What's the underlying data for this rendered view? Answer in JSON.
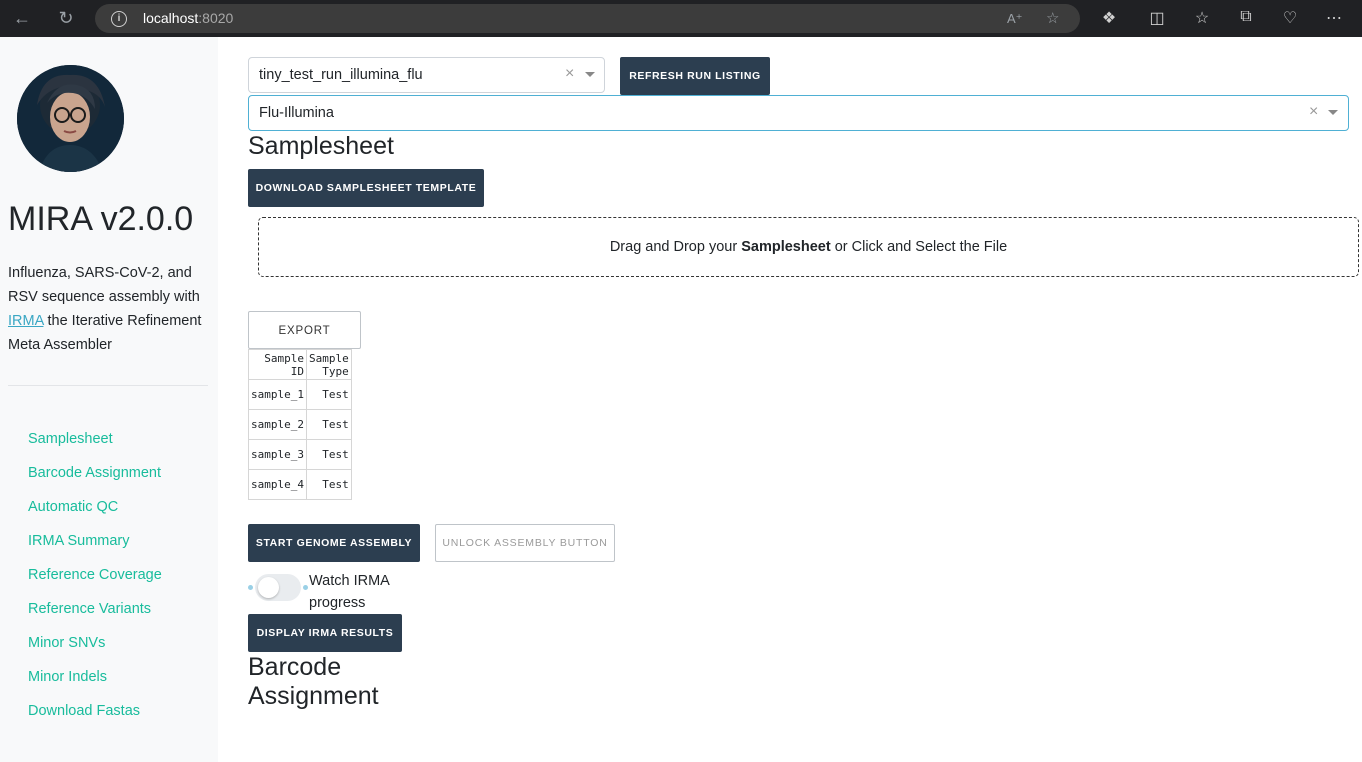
{
  "browser": {
    "url_host": "localhost",
    "url_port": ":8020"
  },
  "sidebar": {
    "title": "MIRA v2.0.0",
    "description_pre": "Influenza, SARS-CoV-2, and RSV sequence assembly with ",
    "description_link": "IRMA",
    "description_post": " the Iterative Refinement Meta Assembler",
    "nav": [
      {
        "label": "Samplesheet"
      },
      {
        "label": "Barcode Assignment"
      },
      {
        "label": "Automatic QC"
      },
      {
        "label": "IRMA Summary"
      },
      {
        "label": "Reference Coverage"
      },
      {
        "label": "Reference Variants"
      },
      {
        "label": "Minor SNVs"
      },
      {
        "label": "Minor Indels"
      },
      {
        "label": "Download Fastas"
      }
    ]
  },
  "main": {
    "run_select": {
      "value": "tiny_test_run_illumina_flu",
      "clear": "×"
    },
    "refresh_button": "REFRESH RUN LISTING",
    "experiment_select": {
      "value": "Flu-Illumina",
      "clear": "×"
    },
    "samplesheet_heading": "Samplesheet",
    "download_template_button": "DOWNLOAD SAMPLESHEET TEMPLATE",
    "upload": {
      "pre": "Drag and Drop your ",
      "bold": "Samplesheet",
      "post": " or Click and Select the File"
    },
    "export_button": "EXPORT",
    "table": {
      "columns": [
        "Sample ID",
        "Sample Type"
      ],
      "rows": [
        [
          "sample_1",
          "Test"
        ],
        [
          "sample_2",
          "Test"
        ],
        [
          "sample_3",
          "Test"
        ],
        [
          "sample_4",
          "Test"
        ]
      ]
    },
    "start_assembly_button": "START GENOME ASSEMBLY",
    "unlock_assembly_button": "UNLOCK ASSEMBLY BUTTON",
    "watch_irma_label": "Watch IRMA progress",
    "watch_irma_on": false,
    "display_results_button": "DISPLAY IRMA RESULTS",
    "barcode_heading": "Barcode Assignment"
  }
}
